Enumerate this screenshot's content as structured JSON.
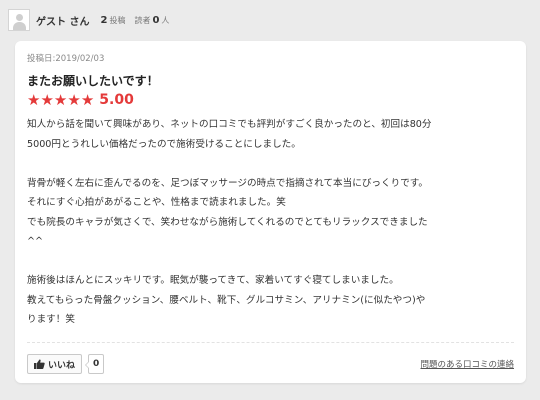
{
  "user": {
    "name": "ゲスト さん",
    "posts_count": "2",
    "posts_label": "投稿",
    "readers_label": "読者",
    "readers_count": "0",
    "readers_unit": "人"
  },
  "review": {
    "date": "投稿日:2019/02/03",
    "title": "またお願いしたいです！",
    "rating": 5,
    "rating_text": "5.00",
    "paragraphs": [
      "知人から話を聞いて興味があり、ネットの口コミでも評判がすごく良かったのと、初回は80分",
      "5000円とうれしい価格だったので施術受けることにしました。",
      "",
      "背骨が軽く左右に歪んでるのを、足つぼマッサージの時点で指摘されて本当にびっくりです。",
      "それにすぐ心拍があがることや、性格まで読まれました。笑",
      "でも院長のキャラが気さくで、笑わせながら施術してくれるのでとてもリラックスできました",
      "^^",
      "",
      "施術後はほんとにスッキリです。眠気が襲ってきて、家着いてすぐ寝てしまいました。",
      "教えてもらった骨盤クッション、腰ベルト、靴下、グルコサミン、アリナミン(に似たやつ)や",
      "ります！笑"
    ]
  },
  "footer": {
    "like_label": "いいね",
    "like_count": "0",
    "report_link": "問題のある口コミの連絡"
  },
  "colors": {
    "accent_red": "#e43a3a",
    "background": "#ebebeb"
  },
  "icons": {
    "avatar": "user-silhouette",
    "like": "thumbs-up-icon",
    "star": "star-icon"
  }
}
